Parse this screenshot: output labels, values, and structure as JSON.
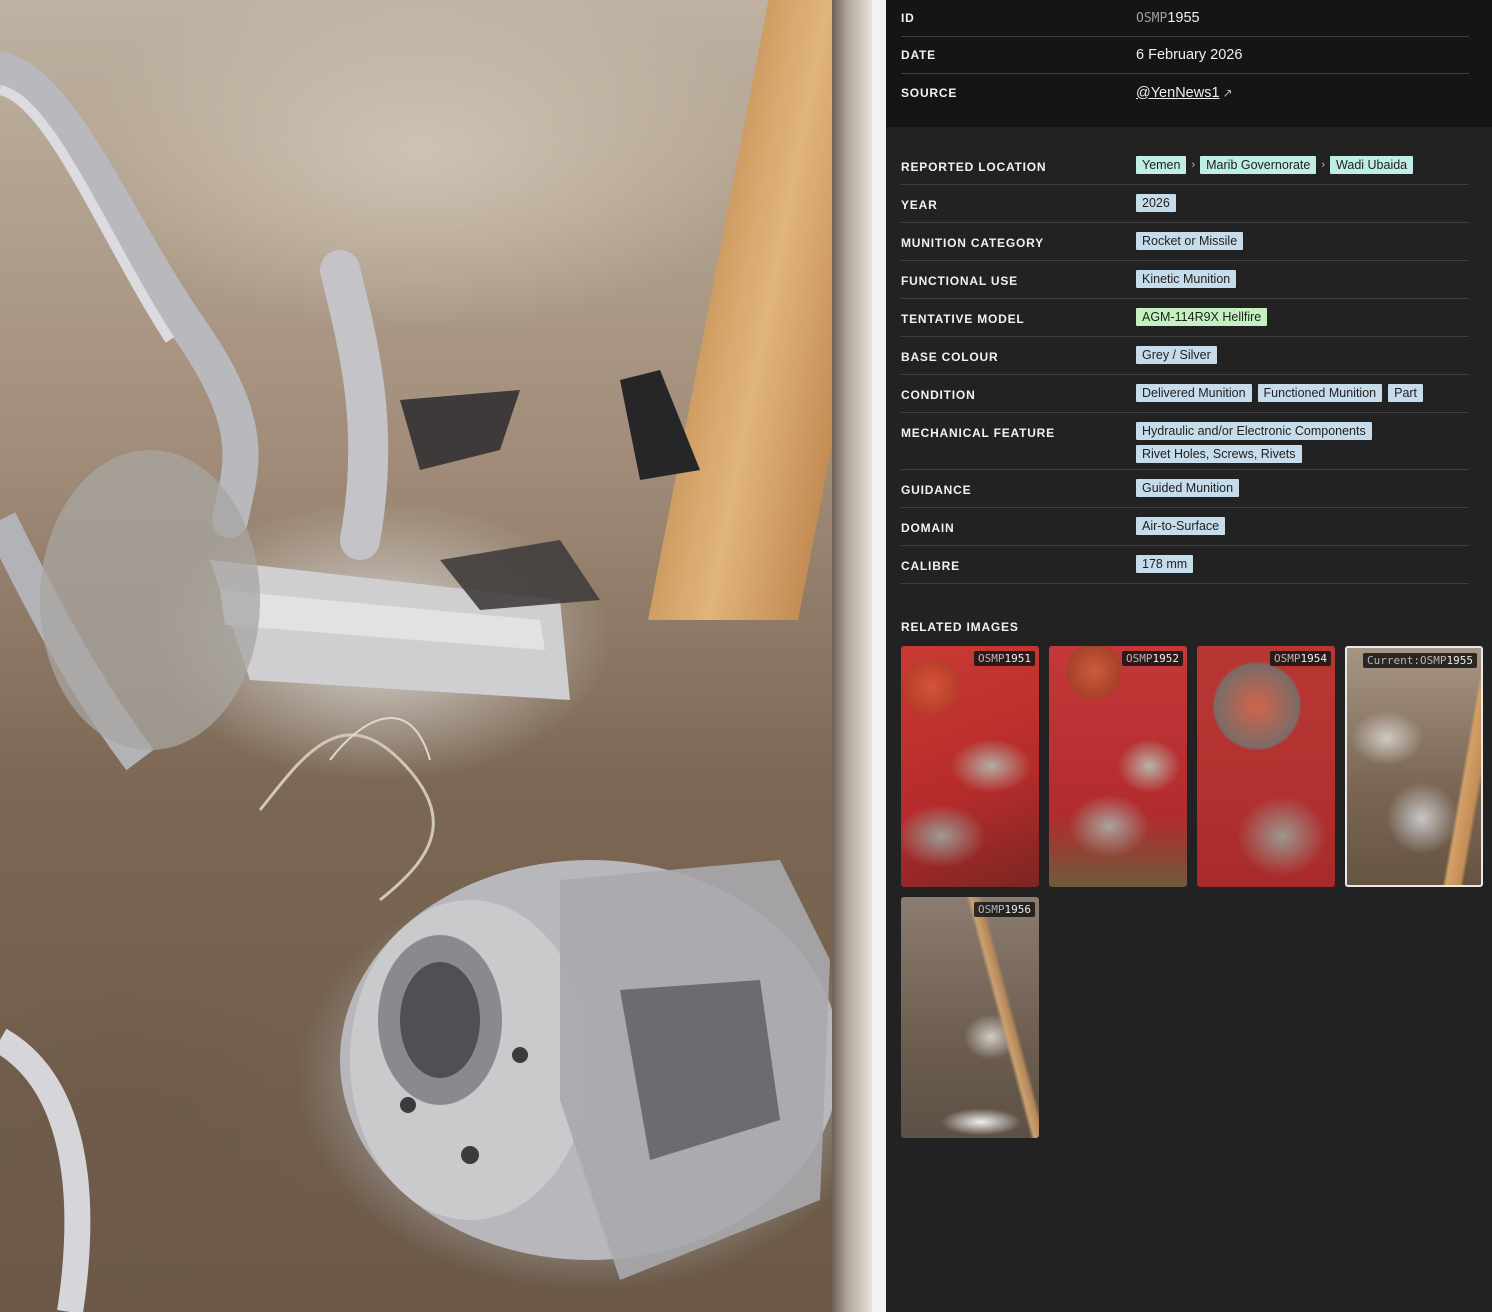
{
  "header": {
    "id_label": "ID",
    "id_prefix": "OSMP",
    "id_number": "1955",
    "date_label": "DATE",
    "date_value": "6 February 2026",
    "source_label": "SOURCE",
    "source_value": "@YenNews1",
    "source_arrow": "↗"
  },
  "details": {
    "location_label": "REPORTED LOCATION",
    "location": [
      "Yemen",
      "Marib Governorate",
      "Wadi Ubaida"
    ],
    "location_sep": "›",
    "year_label": "YEAR",
    "year": "2026",
    "category_label": "MUNITION CATEGORY",
    "category": "Rocket or Missile",
    "functional_label": "FUNCTIONAL USE",
    "functional": "Kinetic Munition",
    "model_label": "TENTATIVE MODEL",
    "model": "AGM-114R9X Hellfire",
    "colour_label": "BASE COLOUR",
    "colour": "Grey / Silver",
    "condition_label": "CONDITION",
    "condition": [
      "Delivered Munition",
      "Functioned Munition",
      "Part"
    ],
    "mechanical_label": "MECHANICAL FEATURE",
    "mechanical": [
      "Hydraulic and/or Electronic Components",
      "Rivet Holes, Screws, Rivets"
    ],
    "guidance_label": "GUIDANCE",
    "guidance": "Guided Munition",
    "domain_label": "DOMAIN",
    "domain": "Air-to-Surface",
    "calibre_label": "CALIBRE",
    "calibre": "178 mm"
  },
  "related": {
    "title": "RELATED IMAGES",
    "current_prefix": "Current:",
    "items": [
      {
        "prefix": "OSMP",
        "number": "1951"
      },
      {
        "prefix": "OSMP",
        "number": "1952"
      },
      {
        "prefix": "OSMP",
        "number": "1954"
      },
      {
        "prefix": "OSMP",
        "number": "1955"
      },
      {
        "prefix": "OSMP",
        "number": "1956"
      }
    ]
  },
  "colors": {
    "panel_bg": "#222222",
    "header_bg": "#151515",
    "tag_blue": "#c7dcea",
    "tag_teal": "#bfeee6",
    "tag_green": "#c5f1c1"
  }
}
